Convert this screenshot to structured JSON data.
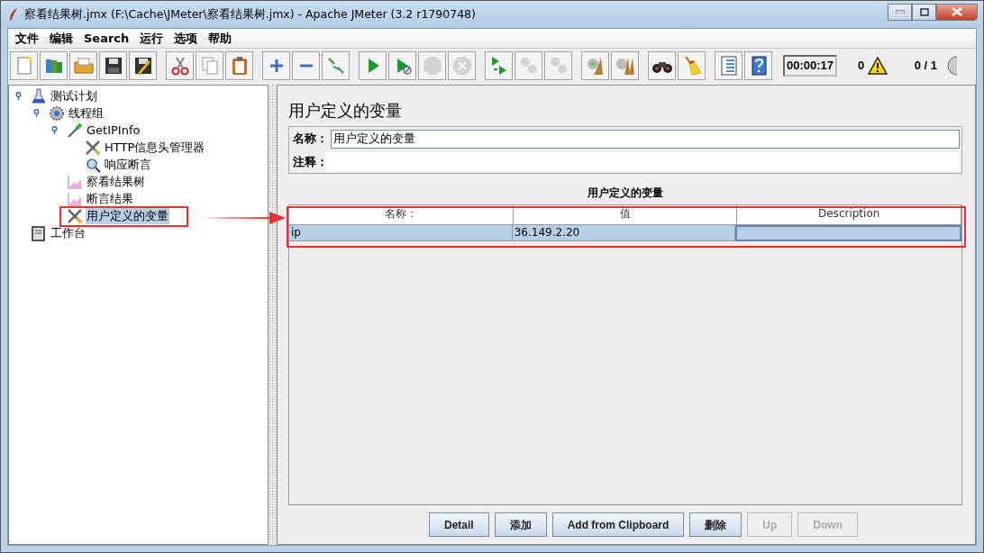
{
  "window": {
    "title": "察看结果树.jmx (F:\\Cache\\JMeter\\察看结果树.jmx) - Apache JMeter (3.2 r1790748)"
  },
  "menu": [
    "文件",
    "编辑",
    "Search",
    "运行",
    "选项",
    "帮助"
  ],
  "toolbar": {
    "groups": [
      [
        {
          "disabled": false
        },
        {
          "disabled": false
        },
        {
          "disabled": false
        },
        {
          "disabled": false
        },
        {
          "disabled": false
        }
      ],
      [
        {
          "disabled": false
        },
        {
          "disabled": false
        },
        {
          "disabled": false
        }
      ],
      [
        {
          "disabled": false
        },
        {
          "disabled": false
        },
        {
          "disabled": false
        }
      ],
      [
        {
          "disabled": false
        },
        {
          "disabled": false
        },
        {
          "disabled": true
        },
        {
          "disabled": true
        }
      ],
      [
        {
          "disabled": false
        },
        {
          "disabled": true
        },
        {
          "disabled": true
        }
      ],
      [
        {
          "disabled": false
        },
        {
          "disabled": false
        }
      ],
      [
        {
          "disabled": false
        },
        {
          "disabled": false
        }
      ],
      [
        {
          "disabled": false
        },
        {
          "disabled": false
        }
      ]
    ],
    "timer": "00:00:17",
    "error_count": "0",
    "threads": "0 / 1"
  },
  "tree": [
    {
      "label": "测试计划",
      "selected": false,
      "expanded": true,
      "children": [
        {
          "label": "线程组",
          "selected": false,
          "expanded": true,
          "children": [
            {
              "label": "GetIPInfo",
              "selected": false,
              "expanded": true,
              "children": [
                {
                  "label": "HTTP信息头管理器",
                  "selected": false
                },
                {
                  "label": "响应断言",
                  "selected": false
                }
              ]
            },
            {
              "label": "察看结果树",
              "selected": false
            },
            {
              "label": "断言结果",
              "selected": false
            },
            {
              "label": "用户定义的变量",
              "selected": true
            }
          ]
        }
      ]
    },
    {
      "label": "工作台",
      "selected": false
    }
  ],
  "panel": {
    "title": "用户定义的变量",
    "name_label": "名称：",
    "name_value": "用户定义的变量",
    "comment_label": "注释：",
    "table": {
      "title": "用户定义的变量",
      "columns": [
        "名称：",
        "值",
        "Description"
      ],
      "rows": [
        {
          "name": "ip",
          "value": "36.149.2.20",
          "selected": true
        }
      ]
    },
    "buttons": [
      {
        "label": "Detail",
        "disabled": false
      },
      {
        "label": "添加",
        "disabled": false
      },
      {
        "label": "Add from Clipboard",
        "disabled": false
      },
      {
        "label": "删除",
        "disabled": false
      },
      {
        "label": "Up",
        "disabled": true
      },
      {
        "label": "Down",
        "disabled": true
      }
    ]
  },
  "annotations": [
    {
      "kind": "box"
    },
    {
      "kind": "arrow"
    },
    {
      "kind": "box"
    }
  ]
}
